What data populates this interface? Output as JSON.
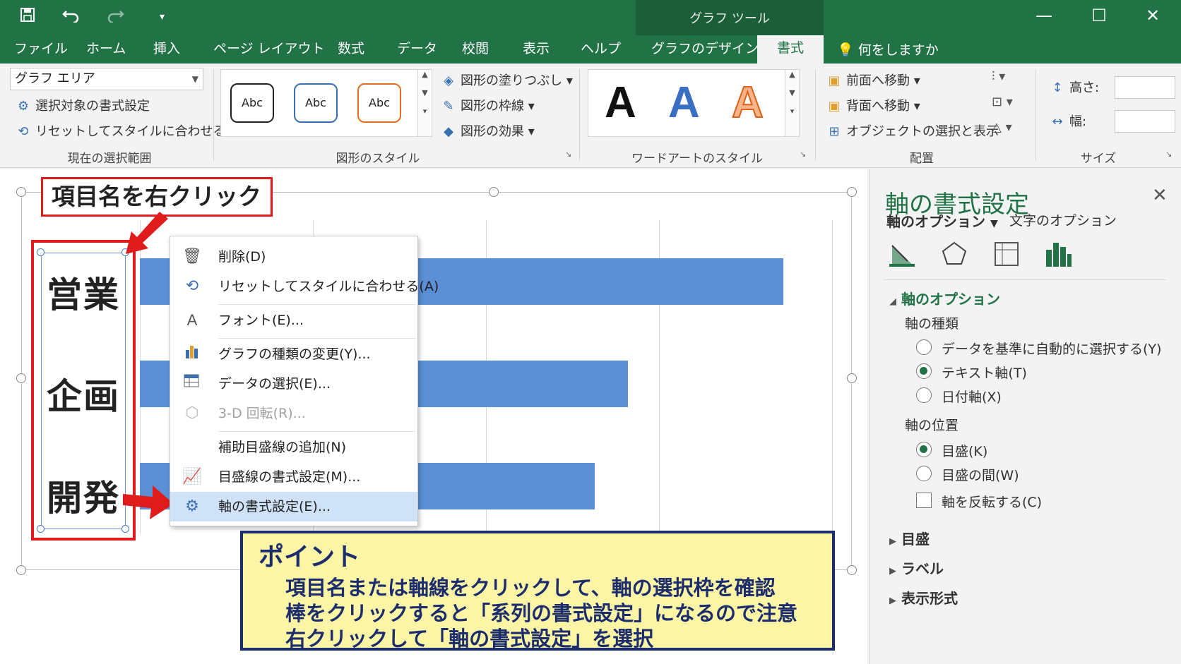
{
  "title_bar": {
    "context_title": "グラフ ツール",
    "icons": [
      "save-icon",
      "undo-icon",
      "redo-icon",
      "customize-qat-icon"
    ],
    "window_buttons": [
      "minimize-icon",
      "maximize-icon",
      "close-icon"
    ]
  },
  "tabs": [
    "ファイル",
    "ホーム",
    "挿入",
    "ページ レイアウト",
    "数式",
    "データ",
    "校閲",
    "表示",
    "ヘルプ",
    "グラフのデザイン",
    "書式"
  ],
  "active_tab": "書式",
  "tell_me": "何をしますか",
  "ribbon": {
    "current_selection": {
      "dropdown_value": "グラフ エリア",
      "format_selection": "選択対象の書式設定",
      "reset_style": "リセットしてスタイルに合わせる",
      "label": "現在の選択範囲"
    },
    "shape_styles": {
      "samples": [
        "Abc",
        "Abc",
        "Abc"
      ],
      "fill": "図形の塗りつぶし",
      "outline": "図形の枠線",
      "effects": "図形の効果",
      "label": "図形のスタイル"
    },
    "wordart": {
      "letters": [
        "A",
        "A",
        "A"
      ],
      "label": "ワードアートのスタイル"
    },
    "arrange": {
      "bring_forward": "前面へ移動",
      "send_backward": "背面へ移動",
      "selection_pane": "オブジェクトの選択と表示",
      "label": "配置"
    },
    "size": {
      "height": "高さ:",
      "width": "幅:",
      "label": "サイズ"
    }
  },
  "chart": {
    "annotation": "項目名を右クリック",
    "categories": [
      "営業",
      "企画",
      "開発"
    ]
  },
  "chart_data": {
    "type": "bar",
    "orientation": "horizontal",
    "categories": [
      "営業",
      "企画",
      "開発"
    ],
    "values": [
      3.72,
      2.82,
      2.63
    ],
    "xlim": [
      0,
      4
    ],
    "grid": true,
    "bar_color": "#5b8fd6"
  },
  "context_menu": {
    "items": [
      {
        "label": "削除(D)",
        "icon": "trash-icon"
      },
      {
        "label": "リセットしてスタイルに合わせる(A)",
        "icon": "reset-style-icon"
      },
      {
        "label": "フォント(E)...",
        "icon": "font-icon"
      },
      {
        "label": "グラフの種類の変更(Y)...",
        "icon": "chart-type-icon"
      },
      {
        "label": "データの選択(E)...",
        "icon": "data-select-icon"
      },
      {
        "label": "3-D 回転(R)...",
        "icon": "3d-rotate-icon"
      },
      {
        "label": "補助目盛線の追加(N)",
        "icon": ""
      },
      {
        "label": "目盛線の書式設定(M)...",
        "icon": "gridline-format-icon"
      },
      {
        "label": "軸の書式設定(E)...",
        "icon": "gear-icon"
      }
    ]
  },
  "point_box": {
    "title": "ポイント",
    "lines": [
      "項目名または軸線をクリックして、軸の選択枠を確認",
      "棒をクリックすると「系列の書式設定」になるので注意",
      "右クリックして「軸の書式設定」を選択"
    ]
  },
  "format_pane": {
    "title": "軸の書式設定",
    "tab_axis_options": "軸のオプション",
    "tab_text_options": "文字のオプション",
    "section_axis_options": "軸のオプション",
    "axis_type_label": "軸の種類",
    "axis_type_options": [
      "データを基準に自動的に選択する(Y)",
      "テキスト軸(T)",
      "日付軸(X)"
    ],
    "axis_position_label": "軸の位置",
    "axis_position_options": [
      "目盛(K)",
      "目盛の間(W)"
    ],
    "reverse_label": "軸を反転する(C)",
    "collapsed_sections": [
      "目盛",
      "ラベル",
      "表示形式"
    ]
  },
  "colors": {
    "excel_green": "#217346",
    "bar_blue": "#5b8fd6",
    "annotation_red": "#e01b1b",
    "point_bg": "#fdf5a6",
    "point_border": "#1c2d6e"
  }
}
